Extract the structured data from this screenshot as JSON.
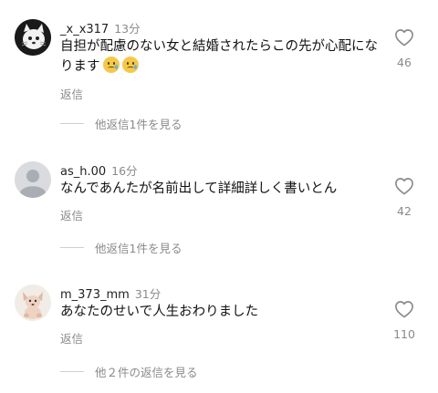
{
  "comments": [
    {
      "username": "_x_x317",
      "time": "13分",
      "text": "自担が配慮のない女と結婚されたらこの先が心配になります",
      "emoji": [
        "crying-face",
        "crying-face"
      ],
      "reply_label": "返信",
      "like_count": "46",
      "more_replies": "他返信1件を見る"
    },
    {
      "username": "as_h.00",
      "time": "16分",
      "text": "なんであんたが名前出して詳細詳しく書いとん",
      "reply_label": "返信",
      "like_count": "42",
      "more_replies": "他返信1件を見る"
    },
    {
      "username": "m_373_mm",
      "time": "31分",
      "text": "あなたのせいで人生おわりました",
      "reply_label": "返信",
      "like_count": "110",
      "more_replies": "他２件の返信を見る"
    }
  ]
}
